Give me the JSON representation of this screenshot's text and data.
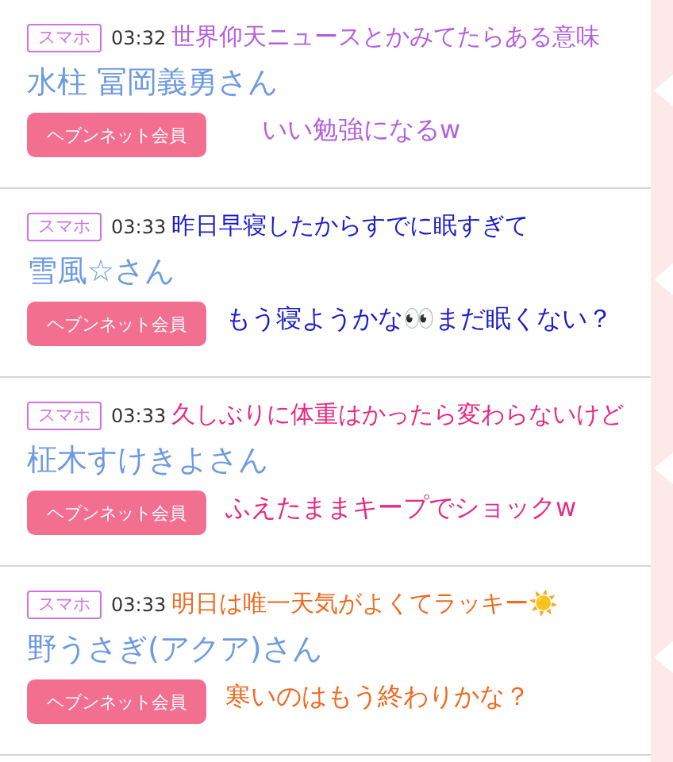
{
  "posts": [
    {
      "badge": "スマホ",
      "time": "03:32",
      "name": "水柱 冨岡義勇さん",
      "button": "ヘブンネット会員",
      "caption": {
        "color": "#b45ee0",
        "lines": [
          "世界仰天ニュースとかみてたらある意味",
          "いい勉強になるw"
        ]
      }
    },
    {
      "badge": "スマホ",
      "time": "03:33",
      "name": "雪風☆さん",
      "button": "ヘブンネット会員",
      "caption": {
        "color": "#1c1ccc",
        "lines": [
          "昨日早寝したからすでに眠すぎて",
          "もう寝ようかな👀まだ眠くない？"
        ]
      }
    },
    {
      "badge": "スマホ",
      "time": "03:33",
      "name": "柾木すけきよさん",
      "button": "ヘブンネット会員",
      "caption": {
        "color": "#e62a80",
        "lines": [
          "久しぶりに体重はかったら変わらないけど",
          "ふえたままキープでショックw"
        ]
      }
    },
    {
      "badge": "スマホ",
      "time": "03:33",
      "name": "野うさぎ(アクア)さん",
      "button": "ヘブンネット会員",
      "caption": {
        "color": "#f06a1e",
        "lines": [
          "明日は唯一天気がよくてラッキー☀️",
          "寒いのはもう終わりかな？"
        ]
      }
    }
  ]
}
